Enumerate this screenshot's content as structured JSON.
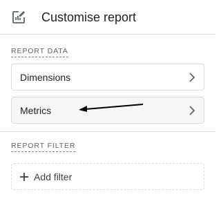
{
  "header": {
    "title": "Customise report",
    "icon": "edit-report-icon"
  },
  "report_data": {
    "label": "REPORT DATA",
    "items": [
      {
        "label": "Dimensions"
      },
      {
        "label": "Metrics"
      }
    ]
  },
  "report_filter": {
    "label": "REPORT FILTER",
    "add_filter_label": "Add filter"
  },
  "colors": {
    "border": "#dadce0",
    "hover_bg": "#f6f6f6",
    "muted": "#5f6368"
  }
}
